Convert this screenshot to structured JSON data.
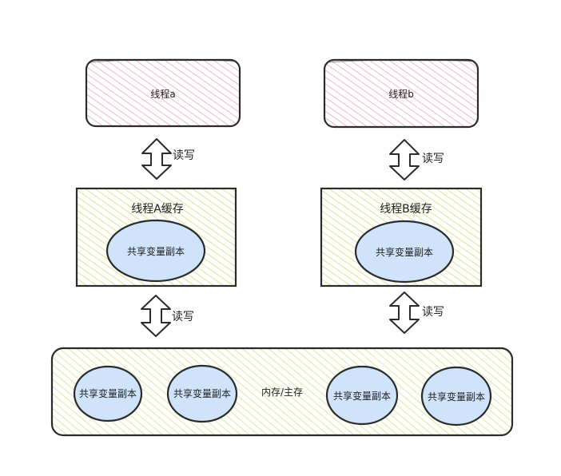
{
  "thread_a": {
    "label": "线程a"
  },
  "thread_b": {
    "label": "线程b"
  },
  "cache_a": {
    "title": "线程A缓存",
    "copy_label": "共享变量副本"
  },
  "cache_b": {
    "title": "线程B缓存",
    "copy_label": "共享变量副本"
  },
  "arrows": {
    "a_top": "读写",
    "b_top": "读写",
    "a_bottom": "读写",
    "b_bottom": "读写"
  },
  "main_memory": {
    "label": "内存/主存",
    "copies": [
      "共享变量副本",
      "共享变量副本",
      "共享变量副本",
      "共享变量副本"
    ]
  },
  "colors": {
    "thread_hatch": "#f4b8c4",
    "cache_hatch": "#dfe89a",
    "memory_hatch": "#dfe89a",
    "ellipse_fill": "#cfe3fa",
    "stroke": "#2b2b2b"
  }
}
